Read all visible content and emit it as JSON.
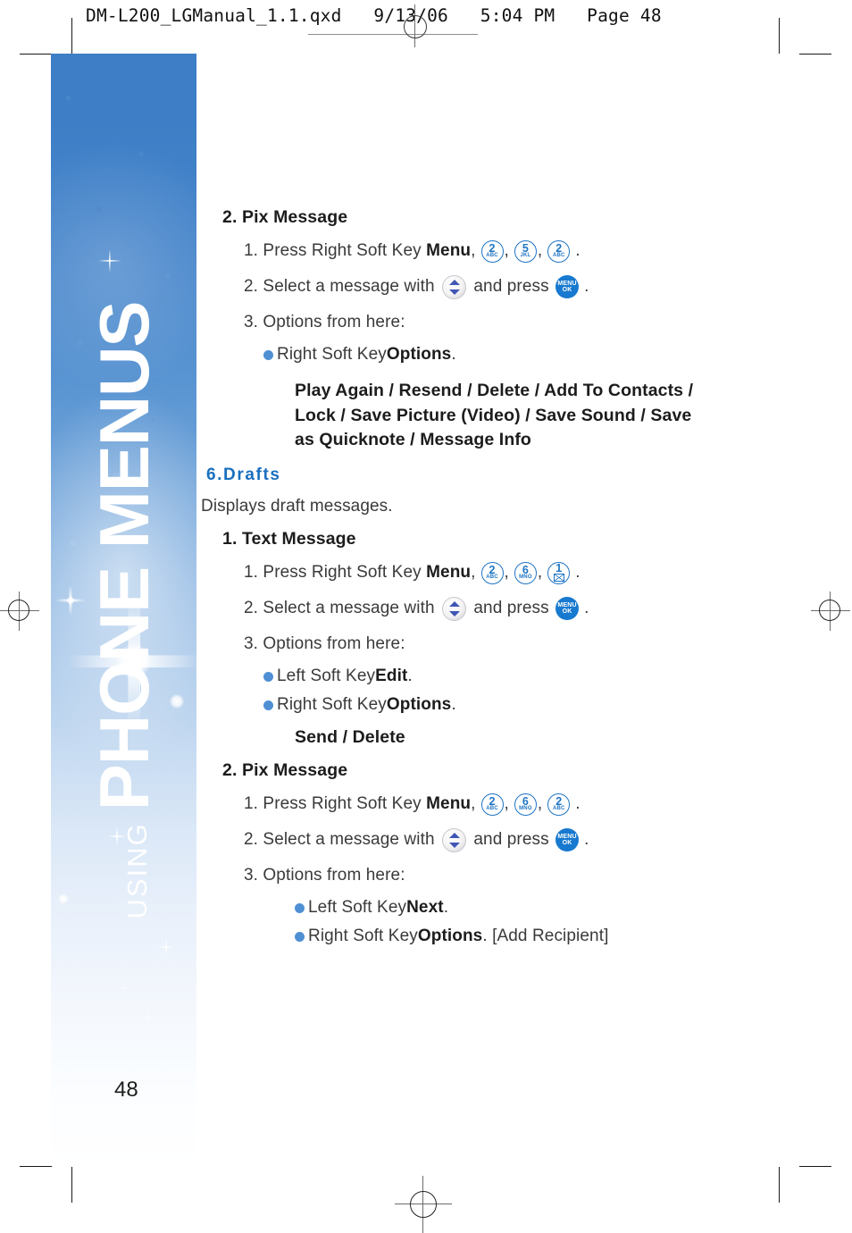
{
  "file_header": {
    "text": "DM-L200_LGManual_1.1.qxd   9/13/06   5:04 PM   Page 48"
  },
  "sidebar": {
    "eyebrow": "USING",
    "title": "PHONE MENUS",
    "page_number": "48",
    "band_top_color": "#3d7ec6",
    "band_bottom_color": "#ffffff"
  },
  "accent_blue": "#1a6fbf",
  "bullet_color": "#4f90d4",
  "key_outline_color": "#1f74c4",
  "menuok_fill": "#1779cf",
  "sections": {
    "pix_top": {
      "heading": "2. Pix Message",
      "step1_a": "1. Press Right Soft Key ",
      "step1_bold": "Menu",
      "step1_comma": ",",
      "keys": [
        {
          "num": "2",
          "letters": "ABC"
        },
        {
          "num": "5",
          "letters": "JKL"
        },
        {
          "num": "2",
          "letters": "ABC"
        }
      ],
      "step1_end": ".",
      "step2_a": "2. Select a message with ",
      "step2_b": " and press ",
      "step2_end": ".",
      "step3": "3. Options from here:",
      "bullet1_a": "Right Soft Key ",
      "bullet1_bold": "Options",
      "bullet1_end": ".",
      "options_list": "Play Again / Resend / Delete / Add To Contacts / Lock / Save Picture (Video) / Save Sound / Save as Quicknote / Message Info"
    },
    "drafts": {
      "heading": "6.Drafts",
      "description": "Displays draft messages."
    },
    "text_message": {
      "heading": "1. Text Message",
      "step1_a": "1. Press Right Soft Key ",
      "step1_bold": "Menu",
      "step1_comma": ",",
      "keys": [
        {
          "num": "2",
          "letters": "ABC"
        },
        {
          "num": "6",
          "letters": "MNO"
        },
        {
          "num": "1",
          "letters": "envelope-glyph"
        }
      ],
      "step1_end": ".",
      "step2_a": "2. Select a message with ",
      "step2_b": " and press ",
      "step2_end": ".",
      "step3": "3. Options from here:",
      "bullet1_a": "Left Soft Key ",
      "bullet1_bold": "Edit",
      "bullet1_end": ".",
      "bullet2_a": "Right Soft Key ",
      "bullet2_bold": "Options",
      "bullet2_end": ".",
      "options_line": "Send / Delete"
    },
    "pix_bottom": {
      "heading": "2. Pix Message",
      "step1_a": "1. Press Right Soft Key ",
      "step1_bold": "Menu",
      "step1_comma": ",",
      "keys": [
        {
          "num": "2",
          "letters": "ABC"
        },
        {
          "num": "6",
          "letters": "MNO"
        },
        {
          "num": "2",
          "letters": "ABC"
        }
      ],
      "step1_end": ".",
      "step2_a": "2. Select a message with ",
      "step2_b": " and press ",
      "step2_end": ".",
      "step3": "3. Options from here:",
      "bullet1_a": "Left Soft Key ",
      "bullet1_bold": "Next",
      "bullet1_end": ".",
      "bullet2_a": "Right Soft Key ",
      "bullet2_bold": "Options",
      "bullet2_end": ". [Add Recipient]"
    }
  },
  "icons": {
    "menu_ok_line1": "MENU",
    "menu_ok_line2": "OK",
    "nav_key": "up-down-navigation-key"
  }
}
